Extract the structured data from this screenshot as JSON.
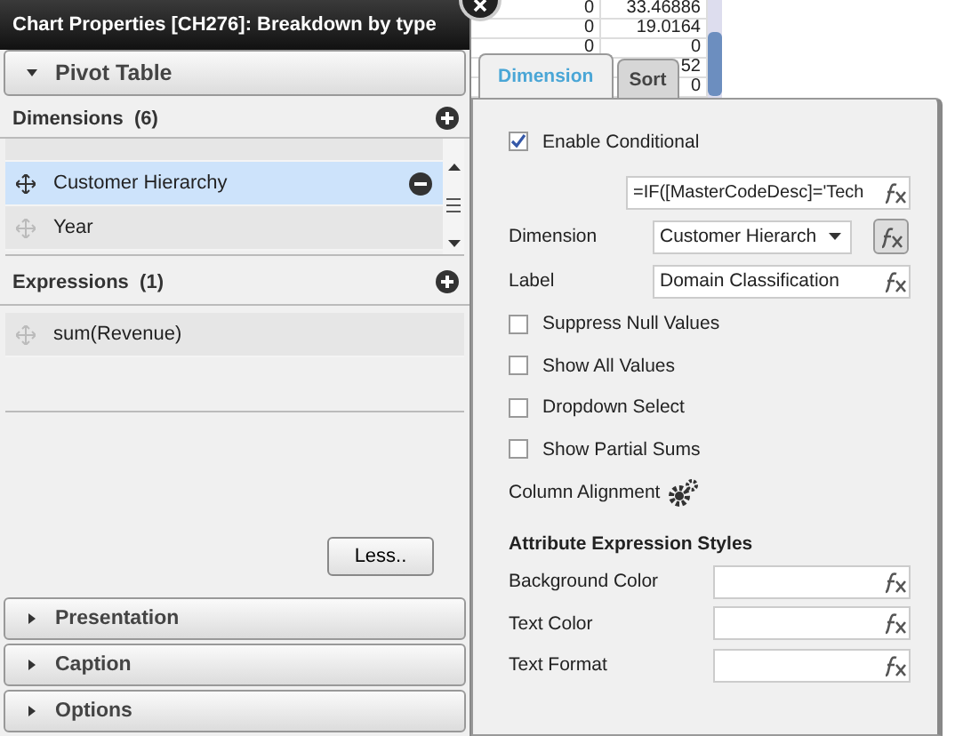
{
  "background_table": {
    "rows": [
      {
        "column_1": "0",
        "column_2": "33.46886"
      },
      {
        "column_1": "0",
        "column_2": "19.0164"
      },
      {
        "column_1": "0",
        "column_2": "0"
      },
      {
        "column_2": "52"
      },
      {
        "column_2": "0"
      }
    ]
  },
  "window": {
    "title": "Chart Properties [CH276]: Breakdown by type"
  },
  "pivot_section": {
    "title": "Pivot Table",
    "expanded": true
  },
  "dimensions": {
    "title": "Dimensions",
    "count": "(6)",
    "items": [
      {
        "label": "Customer Hierarchy",
        "selected": true
      },
      {
        "label": "Year",
        "selected": false
      }
    ]
  },
  "expressions": {
    "title": "Expressions",
    "count": "(1)",
    "items": [
      {
        "label": "sum(Revenue)",
        "selected": false
      }
    ]
  },
  "less_button": "Less..",
  "sections": [
    {
      "title": "Presentation",
      "expanded": false
    },
    {
      "title": "Caption",
      "expanded": false
    },
    {
      "title": "Options",
      "expanded": false
    }
  ],
  "tabs": [
    {
      "label": "Dimension",
      "selected": true
    },
    {
      "label": "Sort",
      "selected": false
    }
  ],
  "enable_conditional": {
    "label": "Enable Conditional",
    "checked": true
  },
  "condition_value": "=IF([MasterCodeDesc]='Tech",
  "dimension": {
    "label": "Dimension",
    "value": "Customer Hierarch"
  },
  "label_field": {
    "label": "Label",
    "value": "Domain Classification"
  },
  "options": [
    {
      "label": "Suppress Null Values",
      "checked": false
    },
    {
      "label": "Show All Values",
      "checked": false
    },
    {
      "label": "Dropdown Select",
      "checked": false
    },
    {
      "label": "Show Partial Sums",
      "checked": false
    }
  ],
  "column_alignment": "Column Alignment",
  "attribute_styles": {
    "title": "Attribute Expression Styles",
    "rows": [
      {
        "label": "Background Color"
      },
      {
        "label": "Text Color"
      },
      {
        "label": "Text Format"
      }
    ]
  }
}
